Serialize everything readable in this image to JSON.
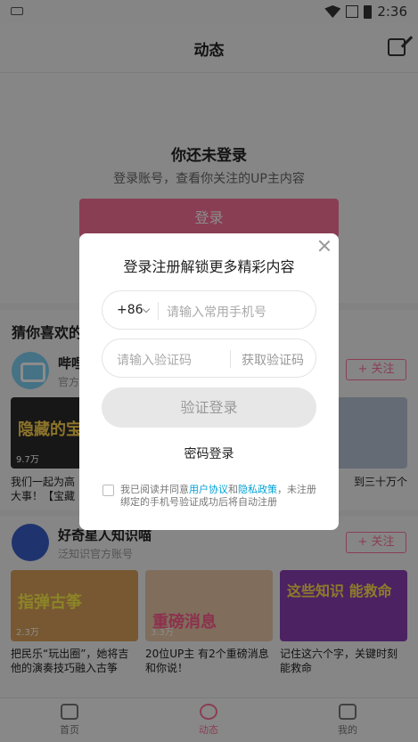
{
  "status": {
    "time": "2:36"
  },
  "header": {
    "title": "动态"
  },
  "hero": {
    "title": "你还未登录",
    "subtitle": "登录账号，查看你关注的UP主内容",
    "login_label": "登录"
  },
  "section": {
    "title": "猜你喜欢的"
  },
  "cards": [
    {
      "name": "哔哩",
      "desc": "官方",
      "follow_label": "+ 关注",
      "videos": [
        {
          "views": "9.7万",
          "overlay": "隐藏的宝",
          "title": "我们一起为高\n大事！【宝藏"
        },
        {
          "views": "",
          "overlay": "",
          "title": ""
        },
        {
          "views": "",
          "overlay": "",
          "title": "到三十万个"
        }
      ]
    },
    {
      "name": "好奇星人知识喵",
      "desc": "泛知识官方账号",
      "follow_label": "+ 关注",
      "videos": [
        {
          "views": "2.3万",
          "overlay": "指弹古筝",
          "title": "把民乐“玩出圈”，她将吉他的演奏技巧融入古筝"
        },
        {
          "views": "3.3万",
          "overlay": "重磅消息",
          "title": "20位UP主 有2个重磅消息和你说！"
        },
        {
          "views": "",
          "overlay": "这些知识 能救命",
          "title": "记住这六个字，关键时刻能救命"
        }
      ]
    }
  ],
  "tabs": [
    {
      "label": "首页",
      "icon": "home-icon"
    },
    {
      "label": "动态",
      "icon": "dynamic-icon"
    },
    {
      "label": "我的",
      "icon": "tv-icon"
    }
  ],
  "modal": {
    "title": "登录注册解锁更多精彩内容",
    "country_code": "+86",
    "phone_placeholder": "请输入常用手机号",
    "code_placeholder": "请输入验证码",
    "get_code_label": "获取验证码",
    "verify_login_label": "验证登录",
    "password_login_label": "密码登录",
    "agree_prefix": "我已阅读并同意",
    "user_agreement": "用户协议",
    "and": "和",
    "privacy_policy": "隐私政策",
    "agree_suffix": "，未注册绑定的手机号验证成功后将自动注册"
  },
  "colors": {
    "accent": "#fb7299",
    "link": "#00a1d6"
  }
}
